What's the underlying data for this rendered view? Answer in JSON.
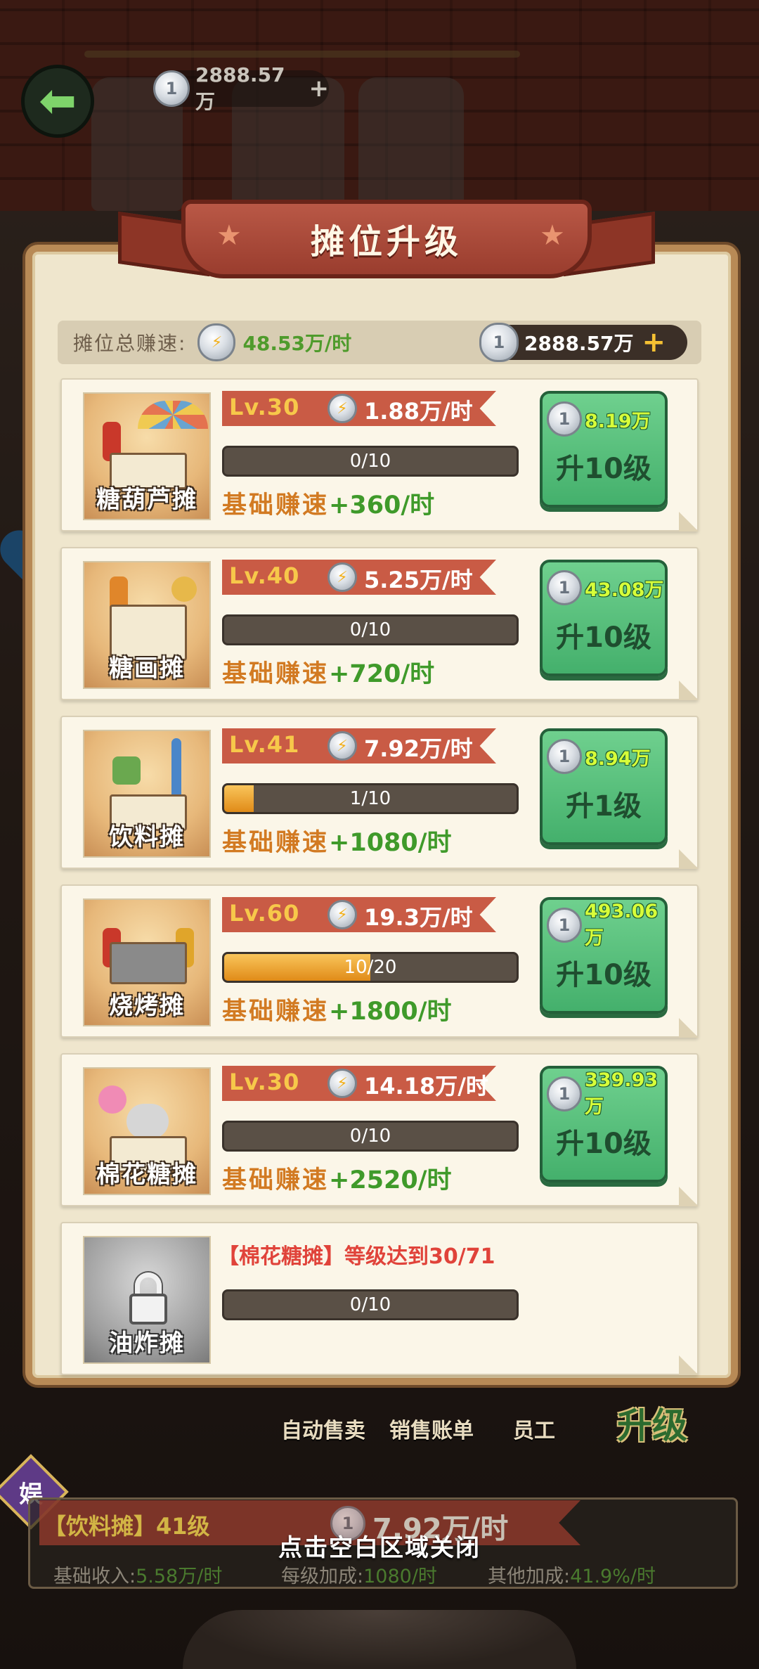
{
  "top": {
    "coins": "2888.57万"
  },
  "panel": {
    "title": "摊位升级",
    "total_rate_label": "摊位总赚速:",
    "total_rate": "48.53万/时",
    "coins": "2888.57万"
  },
  "stalls": [
    {
      "name": "糖葫芦摊",
      "level": "Lv.30",
      "rate": "1.88万/时",
      "progress_text": "0/10",
      "progress": 0.0,
      "base_label": "基础赚速",
      "base_value": "+360/时",
      "price": "8.19万",
      "button": "升10级"
    },
    {
      "name": "糖画摊",
      "level": "Lv.40",
      "rate": "5.25万/时",
      "progress_text": "0/10",
      "progress": 0.0,
      "base_label": "基础赚速",
      "base_value": "+720/时",
      "price": "43.08万",
      "button": "升10级"
    },
    {
      "name": "饮料摊",
      "level": "Lv.41",
      "rate": "7.92万/时",
      "progress_text": "1/10",
      "progress": 0.1,
      "base_label": "基础赚速",
      "base_value": "+1080/时",
      "price": "8.94万",
      "button": "升1级"
    },
    {
      "name": "烧烤摊",
      "level": "Lv.60",
      "rate": "19.3万/时",
      "progress_text": "10/20",
      "progress": 0.5,
      "base_label": "基础赚速",
      "base_value": "+1800/时",
      "price": "493.06万",
      "button": "升10级"
    },
    {
      "name": "棉花糖摊",
      "level": "Lv.30",
      "rate": "14.18万/时",
      "progress_text": "0/10",
      "progress": 0.0,
      "base_label": "基础赚速",
      "base_value": "+2520/时",
      "price": "339.93万",
      "button": "升10级"
    }
  ],
  "locked_stall": {
    "name": "油炸摊",
    "condition": "【棉花糖摊】等级达到30/71",
    "progress_text": "0/10",
    "progress": 0.0
  },
  "toolbar": {
    "auto_sell": "自动售卖",
    "sales_bill": "销售账单",
    "staff": "员工",
    "upgrade": "升级"
  },
  "entertainment_badge": "娱",
  "info": {
    "stall": "【饮料摊】41级",
    "rate": "7.92万/时",
    "base_income_label": "基础收入:",
    "base_income": "5.58万/时",
    "per_level_label": "每级加成:",
    "per_level": "1080/时",
    "other_label": "其他加成:",
    "other": "41.9%/时"
  },
  "close_hint": "点击空白区域关闭",
  "colors": {
    "panel_bg": "#efe6cd",
    "accent_red": "#c95b45",
    "button_green": "#44b06c",
    "rate_green": "#3f9a2a",
    "label_orange": "#d27a22"
  }
}
